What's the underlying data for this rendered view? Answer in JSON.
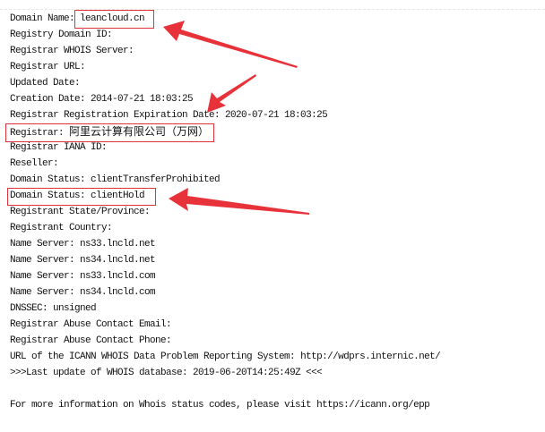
{
  "whois_lines": [
    {
      "label": "Domain Name: ",
      "value": "leancloud.cn"
    },
    {
      "label": "Registry Domain ID:",
      "value": ""
    },
    {
      "label": "Registrar WHOIS Server:",
      "value": ""
    },
    {
      "label": "Registrar URL:",
      "value": ""
    },
    {
      "label": "Updated Date:",
      "value": ""
    },
    {
      "label": "Creation Date: ",
      "value": "2014-07-21 18:03:25"
    },
    {
      "label": "Registrar Registration Expiration Date: ",
      "value": "2020-07-21 18:03:25"
    },
    {
      "label": "Registrar: ",
      "value": "阿里云计算有限公司（万网）"
    },
    {
      "label": "Registrar IANA ID:",
      "value": ""
    },
    {
      "label": "Reseller:",
      "value": ""
    },
    {
      "label": "Domain Status: ",
      "value": "clientTransferProhibited"
    },
    {
      "label": "Domain Status: ",
      "value": "clientHold"
    },
    {
      "label": "Registrant State/Province:",
      "value": ""
    },
    {
      "label": "Registrant Country:",
      "value": ""
    },
    {
      "label": "Name Server: ",
      "value": "ns33.lncld.net"
    },
    {
      "label": "Name Server: ",
      "value": "ns34.lncld.net"
    },
    {
      "label": "Name Server: ",
      "value": "ns33.lncld.com"
    },
    {
      "label": "Name Server: ",
      "value": "ns34.lncld.com"
    },
    {
      "label": "DNSSEC: ",
      "value": "unsigned"
    },
    {
      "label": "Registrar Abuse Contact Email:",
      "value": ""
    },
    {
      "label": "Registrar Abuse Contact Phone:",
      "value": ""
    },
    {
      "label": "URL of the ICANN WHOIS Data Problem Reporting System: ",
      "value": "http://wdprs.internic.net/"
    },
    {
      "label": ">>>Last update of WHOIS database: ",
      "value": "2019-06-20T14:25:49Z <<<"
    },
    {
      "label": "",
      "value": ""
    },
    {
      "label": "For more information on Whois status codes, please visit ",
      "value": "https://icann.org/epp"
    }
  ],
  "annotation_color": "#e0323a"
}
